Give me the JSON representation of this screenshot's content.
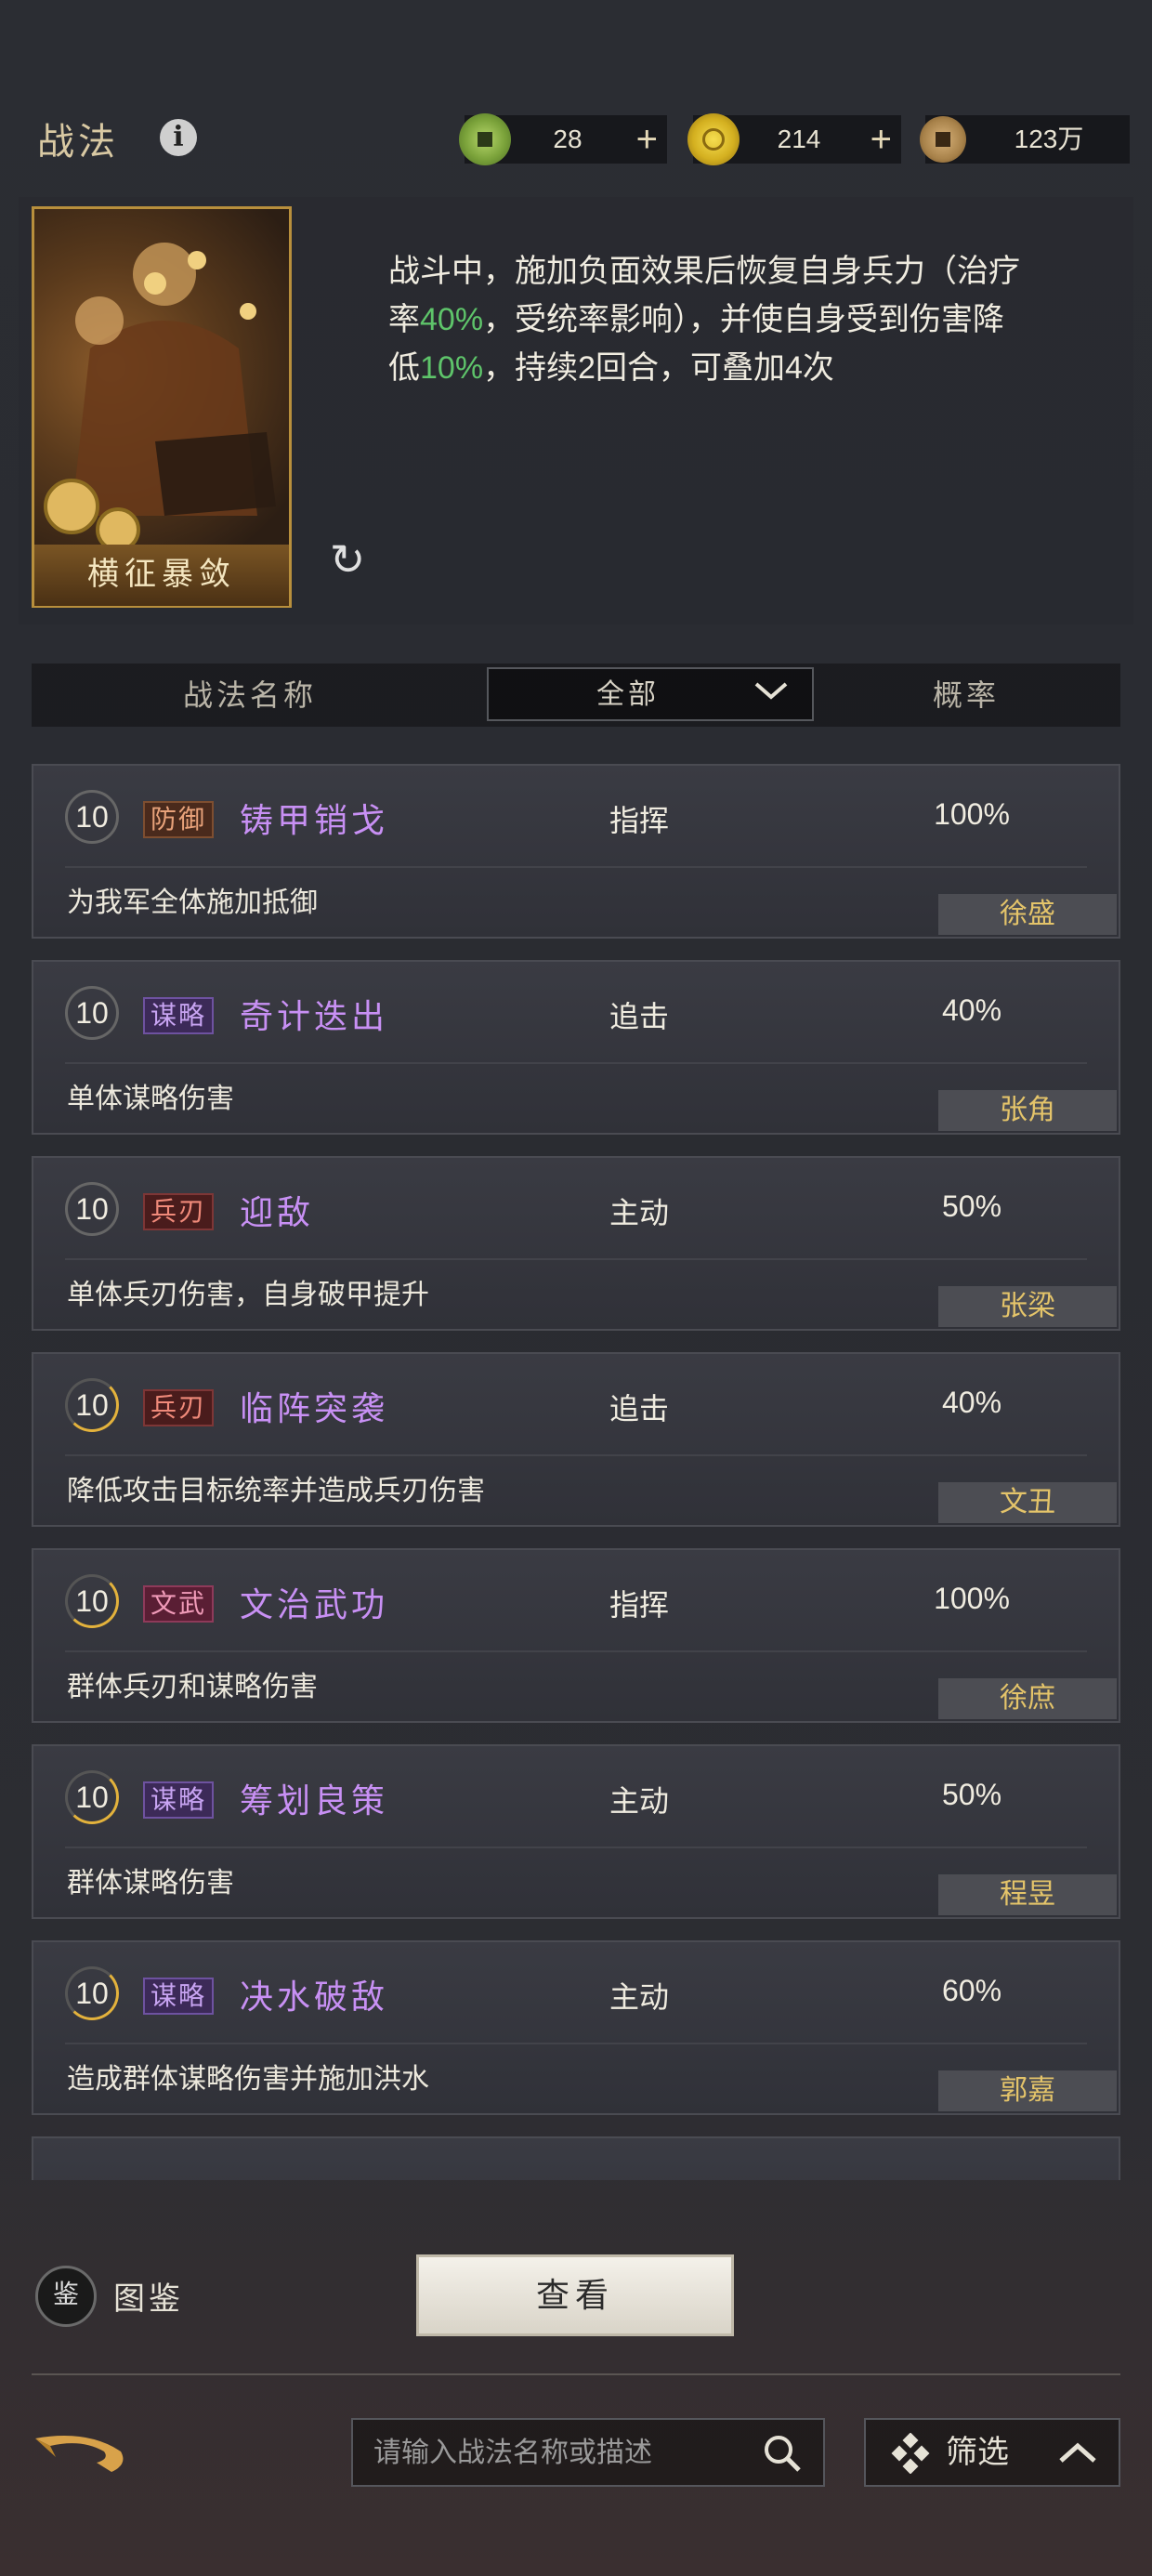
{
  "header": {
    "title": "战法",
    "info_icon": "info-icon",
    "resources": [
      {
        "name": "jade-coin-icon",
        "value": "28",
        "color": "#8ab04a"
      },
      {
        "name": "gold-coin-icon",
        "value": "214",
        "color": "#d4b020"
      },
      {
        "name": "copper-coin-icon",
        "value": "123万",
        "color": "#b08a4a"
      }
    ],
    "plus_label": "+"
  },
  "detail": {
    "card_name": "横征暴敛",
    "desc_1": "战斗中，施加负面效果后恢复自身兵力（治疗率",
    "desc_2": "40%",
    "desc_3": "，受统率影响），并使自身受到伤害降低",
    "desc_4": "10%",
    "desc_5": "，持续2回合，可叠加4次"
  },
  "columns": {
    "name": "战法名称",
    "filter": "全部",
    "rate": "概率"
  },
  "skills": [
    {
      "level": "10",
      "tag": "防御",
      "tag_class": "t-def",
      "name": "铸甲销戈",
      "type": "指挥",
      "rate": "100%",
      "desc": "为我军全体施加抵御",
      "hero": "徐盛",
      "ring": false
    },
    {
      "level": "10",
      "tag": "谋略",
      "tag_class": "t-strat",
      "name": "奇计迭出",
      "type": "追击",
      "rate": "40%",
      "desc": "单体谋略伤害",
      "hero": "张角",
      "ring": false
    },
    {
      "level": "10",
      "tag": "兵刃",
      "tag_class": "t-blade",
      "name": "迎敌",
      "type": "主动",
      "rate": "50%",
      "desc": "单体兵刃伤害，自身破甲提升",
      "hero": "张梁",
      "ring": false
    },
    {
      "level": "10",
      "tag": "兵刃",
      "tag_class": "t-blade",
      "name": "临阵突袭",
      "type": "追击",
      "rate": "40%",
      "desc": "降低攻击目标统率并造成兵刃伤害",
      "hero": "文丑",
      "ring": true
    },
    {
      "level": "10",
      "tag": "文武",
      "tag_class": "t-civmil",
      "name": "文治武功",
      "type": "指挥",
      "rate": "100%",
      "desc": "群体兵刃和谋略伤害",
      "hero": "徐庶",
      "ring": true
    },
    {
      "level": "10",
      "tag": "谋略",
      "tag_class": "t-strat",
      "name": "筹划良策",
      "type": "主动",
      "rate": "50%",
      "desc": "群体谋略伤害",
      "hero": "程昱",
      "ring": true
    },
    {
      "level": "10",
      "tag": "谋略",
      "tag_class": "t-strat",
      "name": "决水破敌",
      "type": "主动",
      "rate": "60%",
      "desc": "造成群体谋略伤害并施加洪水",
      "hero": "郭嘉",
      "ring": true
    }
  ],
  "bottom": {
    "codex_icon_text": "鉴",
    "codex_label": "图鉴",
    "view_button": "查看",
    "search_placeholder": "请输入战法名称或描述",
    "filter_label": "筛选"
  }
}
